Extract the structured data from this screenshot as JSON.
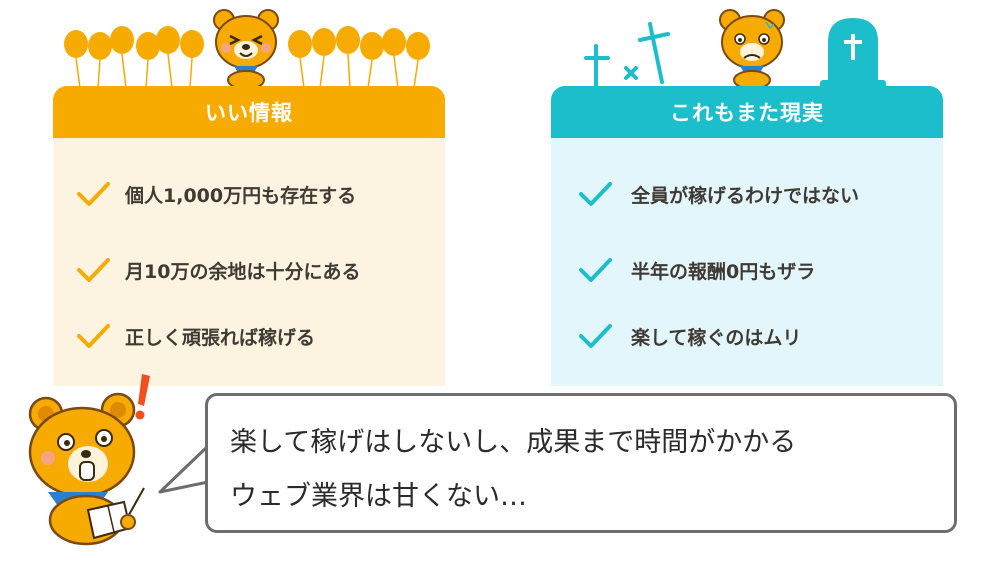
{
  "left_panel": {
    "title": "いい情報",
    "items": [
      "個人1,000万円も存在する",
      "月10万の余地は十分にある",
      "正しく頑張れば稼げる"
    ],
    "colors": {
      "header": "#f7ab00",
      "body": "#fdf3e1",
      "check": "#f7ab00"
    }
  },
  "right_panel": {
    "title": "これもまた現実",
    "items": [
      "全員が稼げるわけではない",
      "半年の報酬0円もザラ",
      "楽して稼ぐのはムリ"
    ],
    "colors": {
      "header": "#1dbecb",
      "body": "#e3f6fb",
      "check": "#1dbecb"
    }
  },
  "speech_bubble": {
    "lines": [
      "楽して稼げはしないし、成果まで時間がかかる",
      "ウェブ業界は甘くない…"
    ]
  },
  "decorations": {
    "left_top": [
      "balloons",
      "happy-bear-icon"
    ],
    "right_top": [
      "grave-crosses",
      "tombstone-icon",
      "worried-bear-icon"
    ],
    "bottom_left": [
      "shocked-bear-icon",
      "exclamation-icon",
      "book-icon"
    ]
  }
}
